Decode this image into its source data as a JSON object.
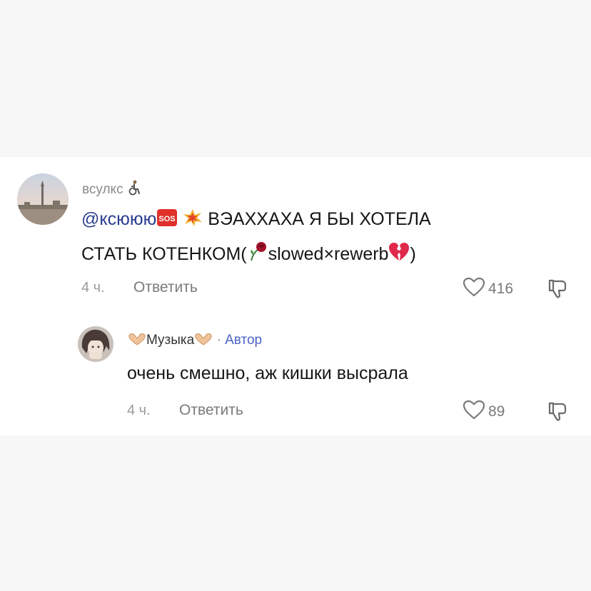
{
  "comments": [
    {
      "username": "всулкс",
      "username_suffix_icon": "wheelchair-icon",
      "mention": "@ксююю",
      "text_line1": "ВЭАХХАХА Я БЫ ХОТЕЛА",
      "text_line2_start": "СТАТЬ КОТЕНКОМ(",
      "text_line2_music": "slowed×rewerb",
      "text_line2_end": ")",
      "time": "4 ч.",
      "reply_label": "Ответить",
      "likes": "416"
    },
    {
      "username": "Музыка",
      "author_separator": "·",
      "author_badge": "Автор",
      "text": "очень смешно, аж кишки высрала",
      "time": "4 ч.",
      "reply_label": "Ответить",
      "likes": "89"
    }
  ],
  "colors": {
    "mention": "#2a3e8e",
    "author_badge": "#4a64c8",
    "meta": "#9a9a9a",
    "text": "#161616"
  }
}
